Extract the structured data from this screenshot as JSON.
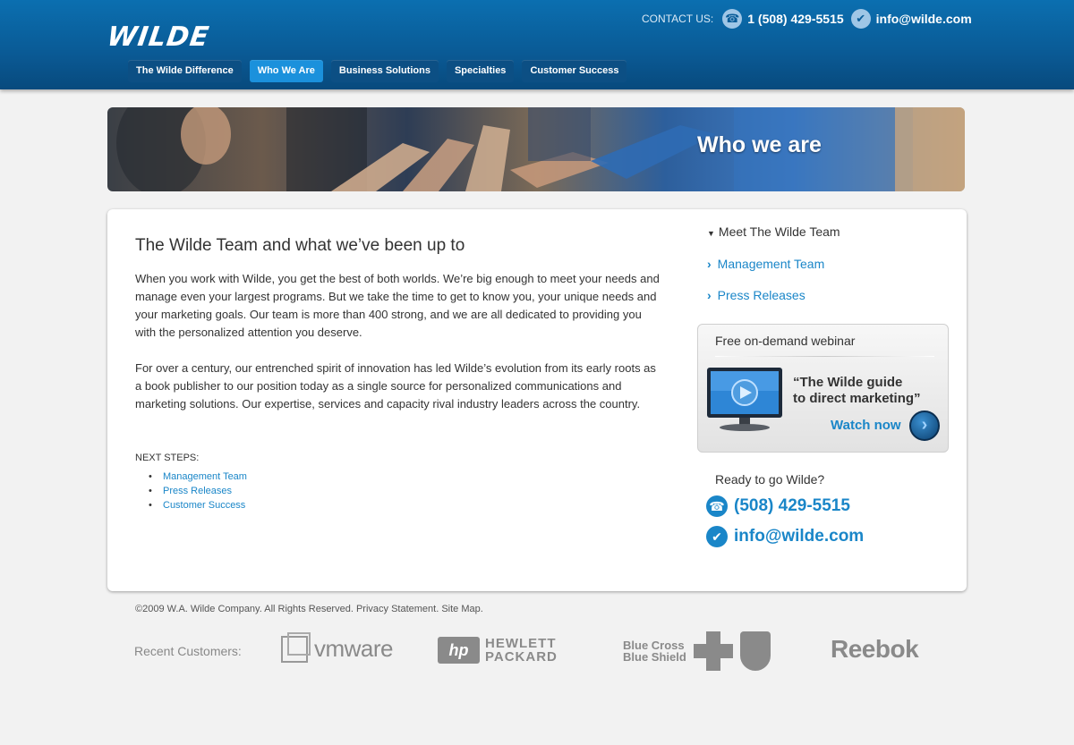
{
  "header": {
    "logo_text": "WILDE",
    "contact_label": "CONTACT US:",
    "phone": "1 (508) 429-5515",
    "email": "info@wilde.com",
    "nav": [
      {
        "label": "The Wilde Difference",
        "active": false
      },
      {
        "label": "Who We Are",
        "active": true
      },
      {
        "label": "Business Solutions",
        "active": false
      },
      {
        "label": "Specialties",
        "active": false
      },
      {
        "label": "Customer Success",
        "active": false
      }
    ]
  },
  "banner": {
    "title": "Who we are"
  },
  "main": {
    "title": "The Wilde Team and what we’ve been up to",
    "paragraphs": [
      "When you work with Wilde, you get the best of both worlds. We’re big enough to meet your needs and manage even your largest programs. But we take the time to get to know you, your unique needs and your marketing goals. Our team is more than 400 strong, and we are all dedicated to providing you with the personalized attention you deserve.",
      "For over a century, our entrenched spirit of innovation has led Wilde’s evolution from its early roots as a book publisher to our position today as a single source for personalized communications and marketing solutions. Our expertise, services and capacity rival industry leaders across the country."
    ],
    "next_steps_label": "NEXT STEPS:",
    "next_steps": [
      "Management Team",
      "Press Releases",
      "Customer Success"
    ]
  },
  "sidebar": {
    "heading": "Meet The Wilde Team",
    "links": [
      "Management Team",
      "Press Releases"
    ],
    "webinar": {
      "title": "Free on-demand webinar",
      "quote_line1": "“The Wilde guide",
      "quote_line2": "to direct marketing”",
      "watch_label": "Watch now"
    },
    "ready_label": "Ready to go Wilde?",
    "phone": "(508) 429-5515",
    "email": "info@wilde.com"
  },
  "footer": {
    "copyright": "©2009 W.A. Wilde Company. All Rights Reserved. Privacy Statement. Site Map.",
    "recent_label": "Recent Customers:",
    "customers": {
      "vmware": "vmware",
      "hp_line1": "HEWLETT",
      "hp_line2": "PACKARD",
      "hp_mark": "hp",
      "bcbs_line1": "Blue Cross",
      "bcbs_line2": "Blue Shield",
      "reebok": "Reebok"
    }
  },
  "colors": {
    "header_blue": "#0a5a95",
    "accent": "#1a86c8",
    "nav_active": "#1b91dc",
    "nav_inactive": "#0c4f84"
  }
}
